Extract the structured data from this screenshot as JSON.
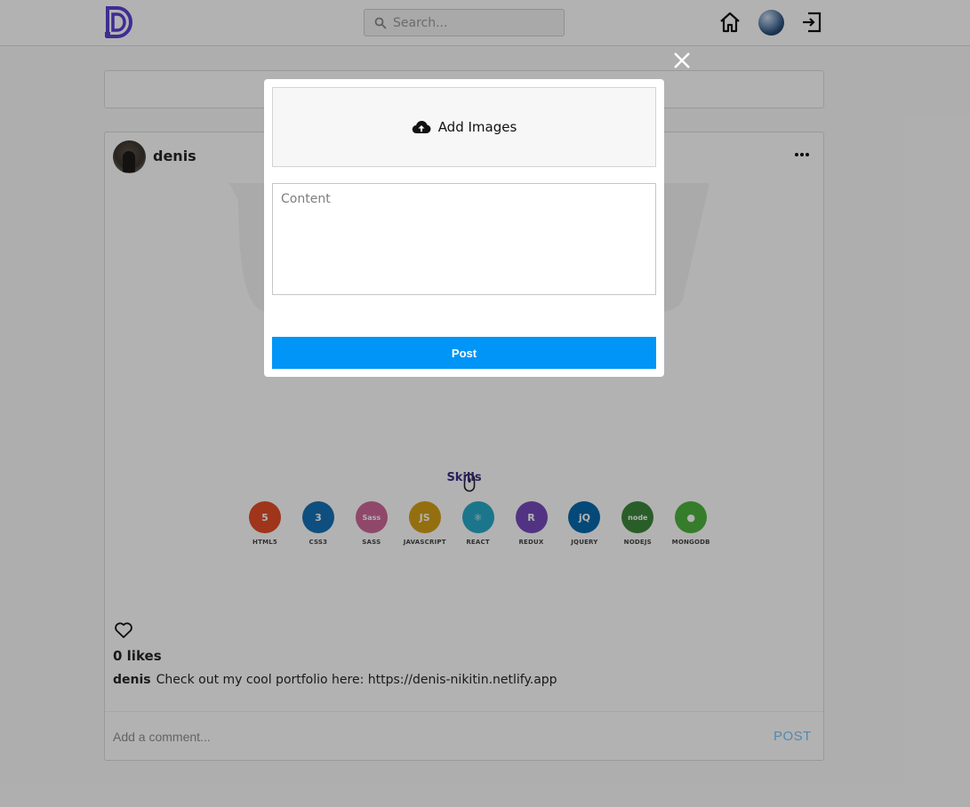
{
  "header": {
    "logo_letter": "D",
    "search_placeholder": "Search...",
    "icons": [
      "home-icon",
      "profile-avatar",
      "logout-icon"
    ]
  },
  "post": {
    "author": "denis",
    "image": {
      "section_title": "Skills",
      "skills": [
        {
          "label": "HTML5",
          "badge": "5",
          "color": "#e44d26"
        },
        {
          "label": "CSS3",
          "badge": "3",
          "color": "#1572b6"
        },
        {
          "label": "SASS",
          "badge": "Sass",
          "color": "#cd6799"
        },
        {
          "label": "JAVASCRIPT",
          "badge": "JS",
          "color": "#d4a017"
        },
        {
          "label": "REACT",
          "badge": "⚛",
          "color": "#27aac7"
        },
        {
          "label": "REDUX",
          "badge": "R",
          "color": "#764abc"
        },
        {
          "label": "JQUERY",
          "badge": "jQ",
          "color": "#0769ad"
        },
        {
          "label": "NODEJS",
          "badge": "node",
          "color": "#3c873a"
        },
        {
          "label": "MONGODB",
          "badge": "●",
          "color": "#4db33d"
        }
      ]
    },
    "likes_text": "0 likes",
    "caption_user": "denis",
    "caption_text": "Check out my cool portfolio here: https://denis-nikitin.netlify.app",
    "comment_placeholder": "Add a comment...",
    "comment_post_label": "POST"
  },
  "modal": {
    "upload_label": "Add Images",
    "content_placeholder": "Content",
    "post_label": "Post"
  },
  "colors": {
    "accent": "#0095f6",
    "logo": "#5b3fd4"
  }
}
